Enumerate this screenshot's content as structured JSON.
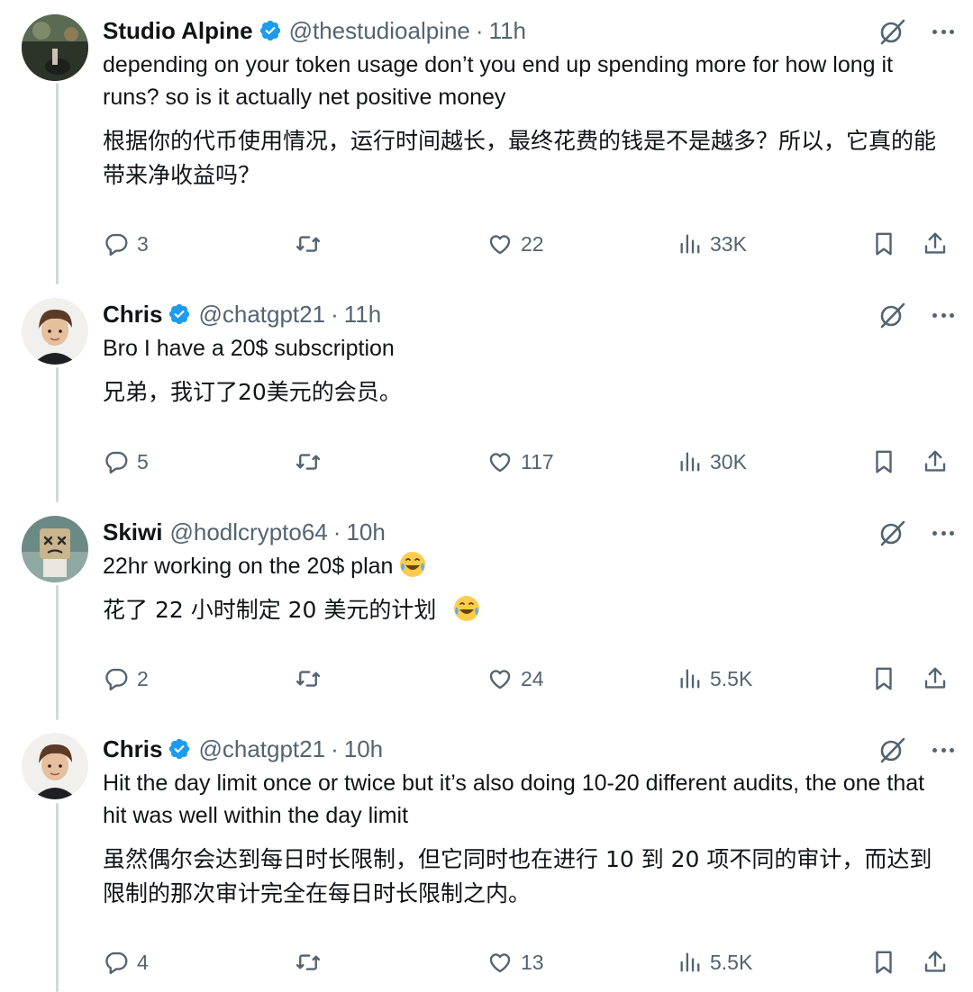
{
  "posts": [
    {
      "name": "Studio Alpine",
      "handle": "@thestudioalpine",
      "separator": "·",
      "time": "11h",
      "text_en": "depending on your token usage don’t you end up spending more for how long it runs? so is it actually net positive money",
      "text_zh": "根据你的代币使用情况，运行时间越长，最终花费的钱是不是越多？所以，它真的能带来净收益吗？",
      "replies": "3",
      "reposts": "",
      "likes": "22",
      "views": "33K"
    },
    {
      "name": "Chris",
      "handle": "@chatgpt21",
      "separator": "·",
      "time": "11h",
      "text_en": "Bro I have a 20$ subscription",
      "text_zh": "兄弟，我订了20美元的会员。",
      "replies": "5",
      "reposts": "",
      "likes": "117",
      "views": "30K"
    },
    {
      "name": "Skiwi",
      "handle": "@hodlcrypto64",
      "separator": "·",
      "time": "10h",
      "text_en": "22hr working on the 20$ plan",
      "text_zh": "花了 22 小时制定 20 美元的计划",
      "replies": "2",
      "reposts": "",
      "likes": "24",
      "views": "5.5K"
    },
    {
      "name": "Chris",
      "handle": "@chatgpt21",
      "separator": "·",
      "time": "10h",
      "text_en": "Hit the day limit once or twice but it’s also doing 10-20 different audits, the one that hit  was well within the day limit",
      "text_zh": "虽然偶尔会达到每日时长限制，但它同时也在进行 10 到 20 项不同的审计，而达到限制的那次审计完全在每日时长限制之内。",
      "replies": "4",
      "reposts": "",
      "likes": "13",
      "views": "5.5K"
    }
  ],
  "icons": {
    "verified": "verified-badge-icon",
    "grok": "grok-icon",
    "more": "more-icon",
    "reply": "reply-icon",
    "repost": "repost-icon",
    "like": "like-icon",
    "views": "views-icon",
    "bookmark": "bookmark-icon",
    "share": "share-icon",
    "emoji": "face-with-tears-of-joy-emoji"
  },
  "colors": {
    "text": "#0f1419",
    "secondary": "#536471",
    "verified": "#1d9bf0",
    "thread_line": "#cfd9de"
  }
}
